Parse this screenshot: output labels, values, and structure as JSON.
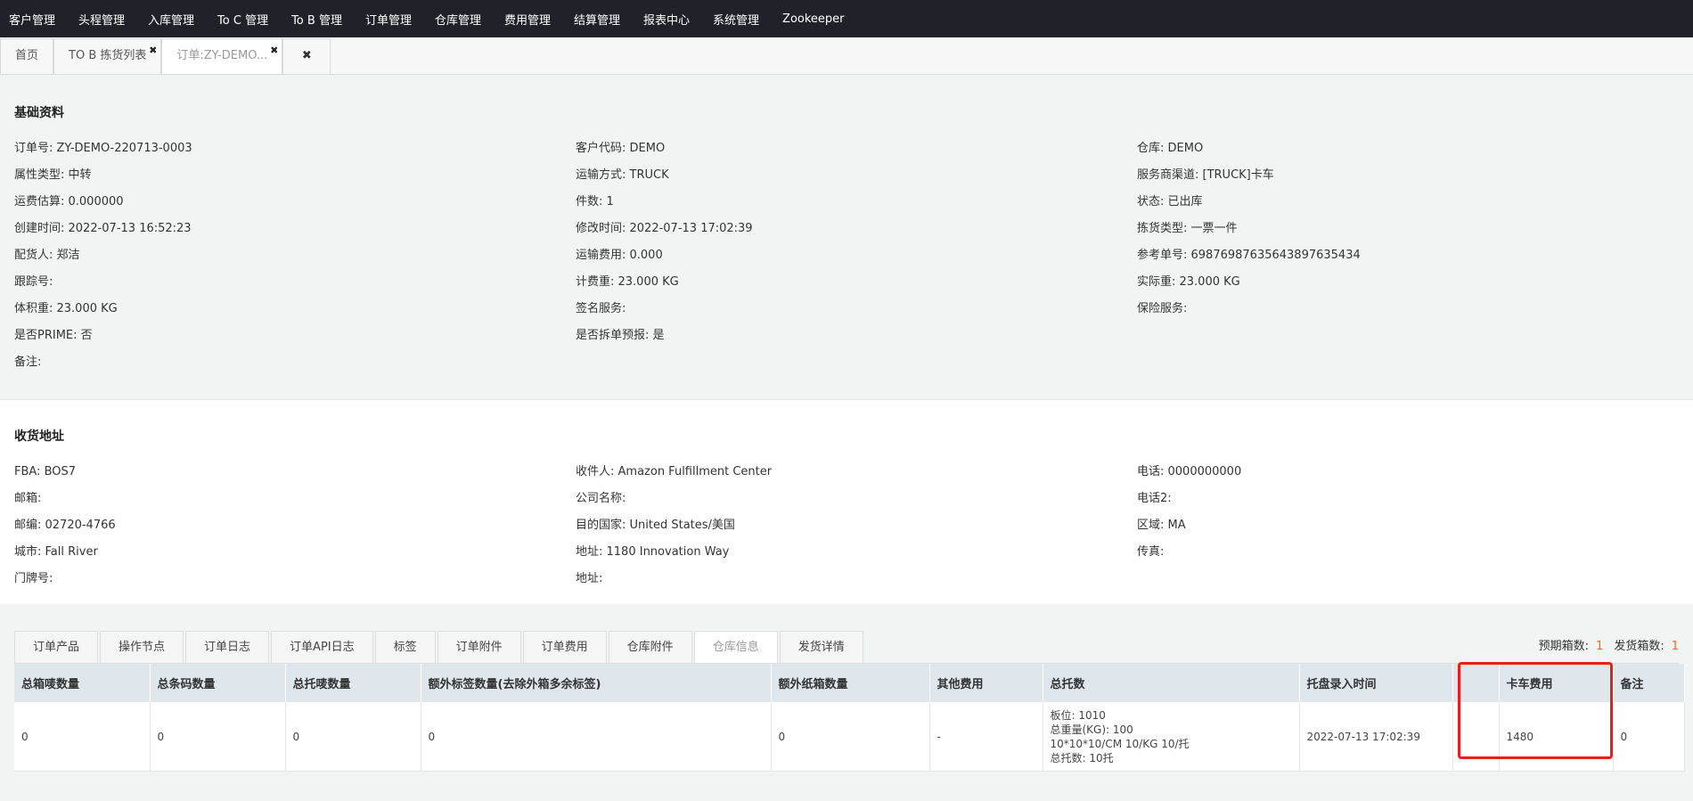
{
  "nav": [
    "客户管理",
    "头程管理",
    "入库管理",
    "To C 管理",
    "To B 管理",
    "订单管理",
    "仓库管理",
    "费用管理",
    "结算管理",
    "报表中心",
    "系统管理",
    "Zookeeper"
  ],
  "tabs": {
    "home": "首页",
    "picking": "TO B 拣货列表",
    "order": "订单:ZY-DEMO...",
    "close_icon": "✖",
    "close_all_icon": "✖"
  },
  "basic": {
    "title": "基础资料",
    "rows": [
      [
        "订单号: ZY-DEMO-220713-0003",
        "客户代码: DEMO",
        "仓库: DEMO"
      ],
      [
        "属性类型: 中转",
        "运输方式: TRUCK",
        "服务商渠道: [TRUCK]卡车"
      ],
      [
        "运费估算: 0.000000",
        "件数: 1",
        "状态: 已出库"
      ],
      [
        "创建时间: 2022-07-13 16:52:23",
        "修改时间: 2022-07-13 17:02:39",
        "拣货类型: 一票一件"
      ],
      [
        "配货人: 郑洁",
        "运输费用: 0.000",
        "参考单号: 69876987635643897635434"
      ],
      [
        "跟踪号:",
        "计费重: 23.000 KG",
        "实际重: 23.000 KG"
      ],
      [
        "体积重: 23.000 KG",
        "签名服务:",
        "保险服务:"
      ],
      [
        "是否PRIME: 否",
        "是否拆单预报: 是",
        ""
      ],
      [
        "备注:",
        "",
        ""
      ]
    ]
  },
  "address": {
    "title": "收货地址",
    "rows": [
      [
        "FBA: BOS7",
        "收件人: Amazon Fulfillment Center",
        "电话: 0000000000"
      ],
      [
        "邮箱:",
        "公司名称:",
        "电话2:"
      ],
      [
        "邮编: 02720-4766",
        "目的国家: United States/美国",
        "区域: MA"
      ],
      [
        "城市: Fall River",
        "地址: 1180 Innovation Way",
        "传真:"
      ],
      [
        "门牌号:",
        "地址:",
        ""
      ]
    ]
  },
  "detail_tabs": [
    "订单产品",
    "操作节点",
    "订单日志",
    "订单API日志",
    "标签",
    "订单附件",
    "订单费用",
    "仓库附件",
    "仓库信息",
    "发货详情"
  ],
  "box_counts": {
    "expected_label": "预期箱数:",
    "expected": "1",
    "shipped_label": "发货箱数:",
    "shipped": "1"
  },
  "table": {
    "headers": [
      "总箱唛数量",
      "总条码数量",
      "总托唛数量",
      "额外标签数量(去除外箱多余标签)",
      "额外纸箱数量",
      "其他费用",
      "总托数",
      "托盘录入时间",
      "",
      "卡车费用",
      "备注"
    ],
    "row": {
      "c1": "0",
      "c2": "0",
      "c3": "0",
      "c4": "0",
      "c5": "0",
      "c6": "-",
      "pallet_lines": [
        "板位: 1010",
        "总重量(KG): 100",
        "10*10*10/CM 10/KG 10/托",
        "总托数: 10托"
      ],
      "time": "2022-07-13 17:02:39",
      "blank": "",
      "truck_fee": "1480",
      "remark": "0"
    }
  }
}
